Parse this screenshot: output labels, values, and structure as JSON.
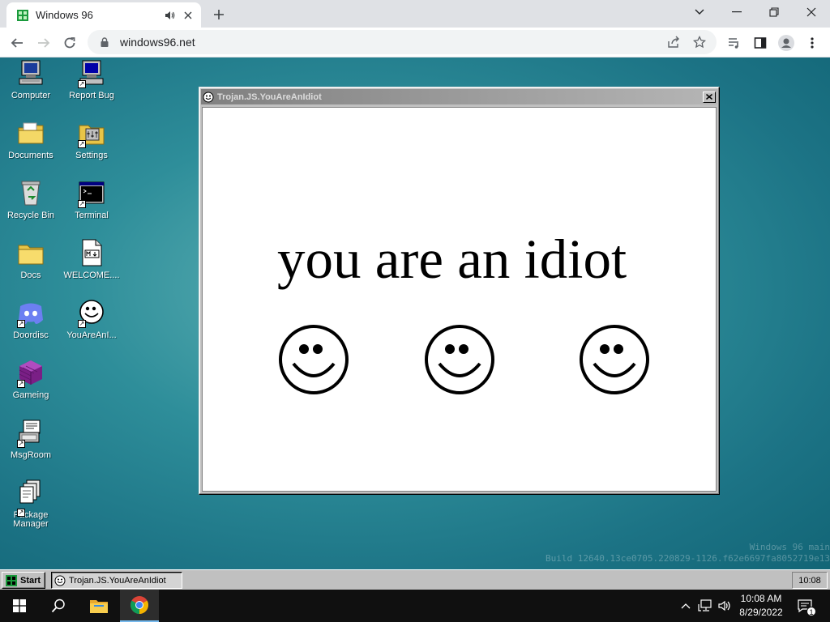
{
  "browser": {
    "tab_title": "Windows 96",
    "url": "windows96.net"
  },
  "desktop": {
    "icons_left": [
      {
        "label": "Computer"
      },
      {
        "label": "Documents"
      },
      {
        "label": "Recycle Bin"
      },
      {
        "label": "Docs"
      },
      {
        "label": "Doordisc"
      },
      {
        "label": "Gameing"
      },
      {
        "label": "MsgRoom"
      },
      {
        "label": "Package Manager"
      }
    ],
    "icons_right": [
      {
        "label": "Report Bug"
      },
      {
        "label": "Settings"
      },
      {
        "label": "Terminal"
      },
      {
        "label": "WELCOME...."
      },
      {
        "label": "YouAreAnI..."
      }
    ],
    "build_line1": "Windows 96 main",
    "build_line2": "Build 12640.13ce0705.220829-1126.f62e6697fa8052719e13"
  },
  "window": {
    "title": "Trojan.JS.YouAreAnIdiot",
    "message": "you are an idiot"
  },
  "w96_taskbar": {
    "start_label": "Start",
    "task_label": "Trojan.JS.YouAreAnIdiot",
    "clock": "10:08"
  },
  "os_taskbar": {
    "time": "10:08 AM",
    "date": "8/29/2022",
    "notification_count": "1"
  },
  "colors": {
    "desktop_teal": "#2e8e9a",
    "win96_gray": "#c0c0c0",
    "titlebar_inactive": "#808080"
  }
}
